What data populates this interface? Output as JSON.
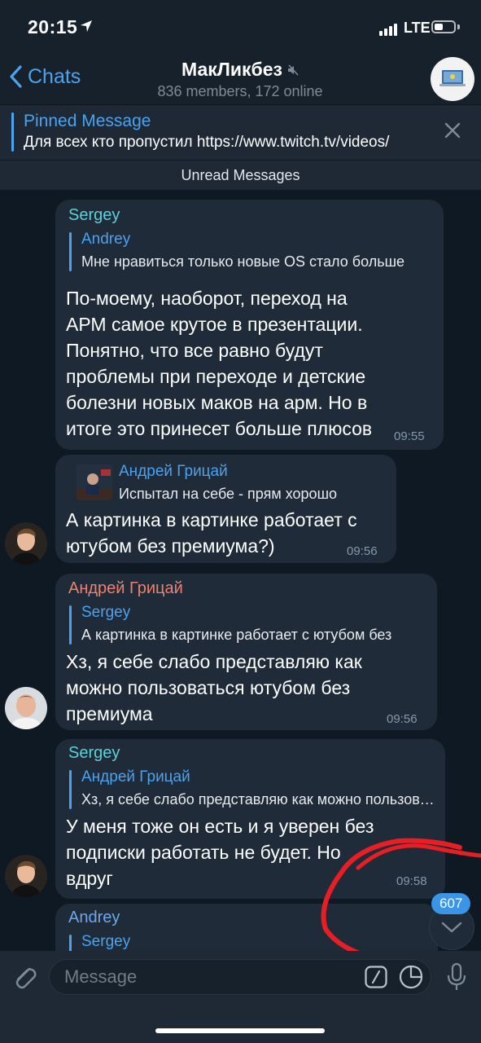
{
  "status_bar": {
    "time": "20:15",
    "network": "LTE"
  },
  "header": {
    "back_label": "Chats",
    "title": "МакЛикбез",
    "subtitle": "836 members, 172 online"
  },
  "pinned": {
    "title": "Pinned Message",
    "text": "Для всех кто пропустил https://www.twitch.tv/videos/"
  },
  "unread_label": "Unread Messages",
  "messages": [
    {
      "sender": "Sergey",
      "reply_name": "Andrey",
      "reply_text": "Мне нравиться только новые OS стало больше",
      "text": "По-моему, наоборот, переход на\nАРМ самое крутое в презентации.\nПонятно, что все равно будут\nпроблемы при переходе и детские\nболезни новых маков на арм. Но в\nитоге это принесет больше плюсов",
      "time": "09:55"
    },
    {
      "reply_name": "Андрей Грицай",
      "reply_text": "Испытал на себе - прям хорошо",
      "text": "А картинка в картинке работает с\nютубом без премиума?)",
      "time": "09:56"
    },
    {
      "sender": "Андрей Грицай",
      "reply_name": "Sergey",
      "reply_text": "А картинка в картинке работает с ютубом без",
      "text": "Хз, я себе слабо представляю как\nможно пользоваться ютубом без\nпремиума",
      "time": "09:56"
    },
    {
      "sender": "Sergey",
      "reply_name": "Андрей Грицай",
      "reply_text": "Хз, я себе слабо представляю как можно пользоваться",
      "text": "У меня тоже он есть и я уверен без\nподписки работать не будет. Но\nвдруг",
      "time": "09:58"
    },
    {
      "sender": "Andrey",
      "reply_name": "Sergey"
    }
  ],
  "unread_count": "607",
  "input": {
    "placeholder": "Message"
  },
  "colors": {
    "background": "#17212b",
    "chat_background": "#0f1923",
    "bubble": "#1f2b38",
    "accent": "#4aa3f0",
    "sergey": "#5ad2d8",
    "andrey_g": "#f0806f",
    "andrey": "#6aa9f0",
    "annotation": "#e81e25"
  }
}
